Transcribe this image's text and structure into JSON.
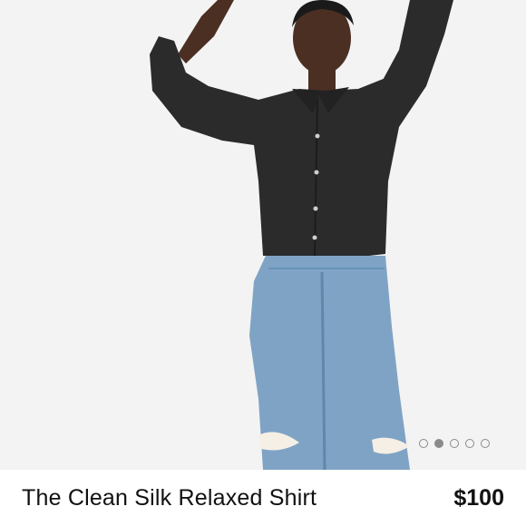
{
  "product": {
    "title": "The Clean Silk Relaxed Shirt",
    "price": "$100"
  },
  "carousel": {
    "total_slides": 5,
    "active_index": 1
  },
  "colors": {
    "shirt": "#2b2b2b",
    "denim": "#7fa3c4",
    "background": "#f3f3f3"
  }
}
